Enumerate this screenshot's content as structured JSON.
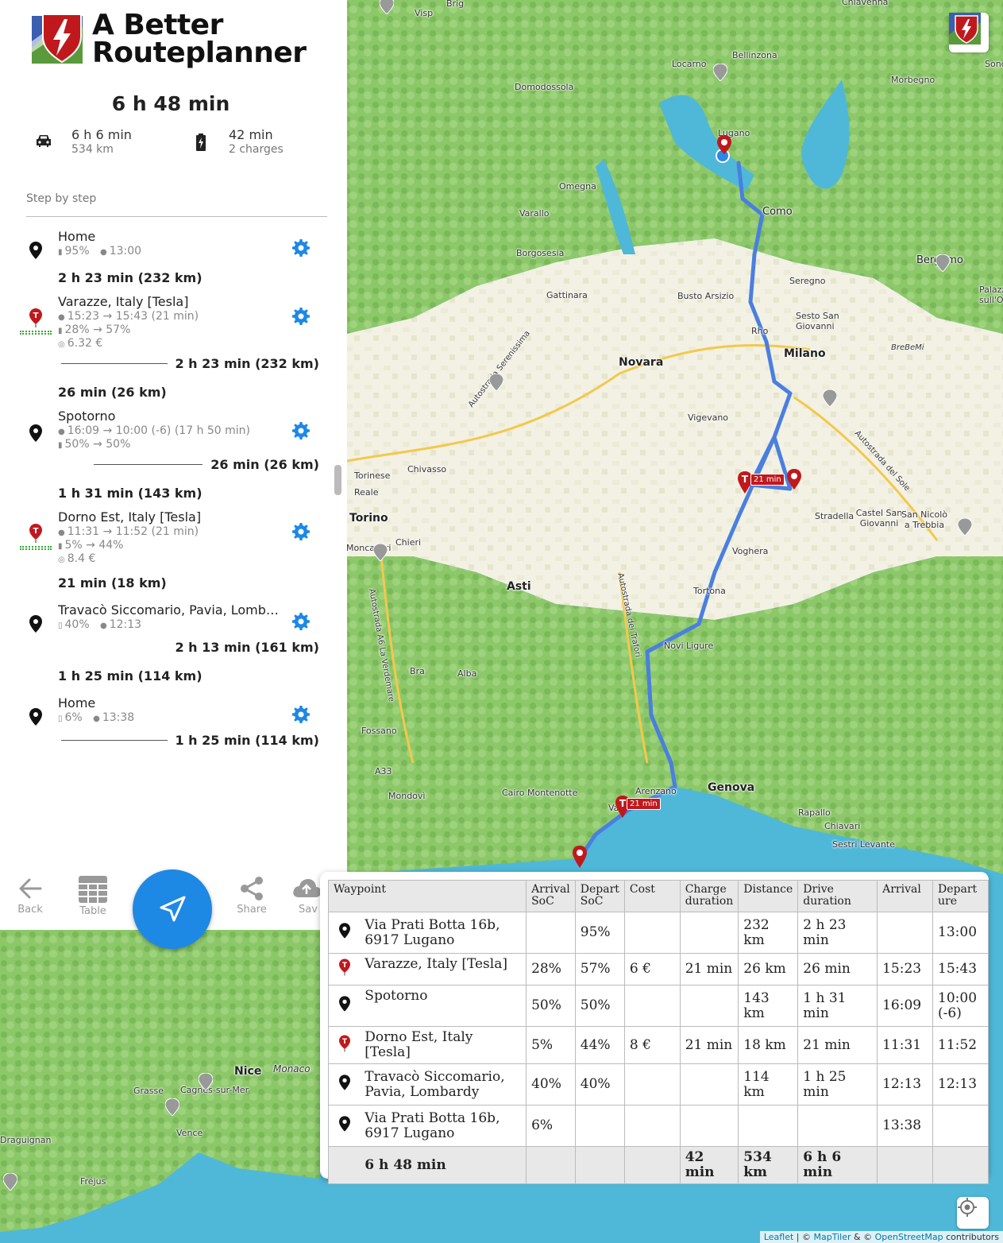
{
  "brand": {
    "line1": "A Better",
    "line2": "Routeplanner"
  },
  "summary": {
    "total": "6 h 48 min",
    "drive_time": "6 h 6 min",
    "drive_distance": "534 km",
    "charge_time": "42 min",
    "charge_count": "2 charges"
  },
  "steps_title": "Step by step",
  "steps": [
    {
      "name": "Home",
      "soc": "95%",
      "time": "13:00"
    },
    {
      "leg": "2 h 23 min (232 km)"
    },
    {
      "name": "Varazze, Italy [Tesla]",
      "time": "15:23 → 15:43 (21 min)",
      "soc": "28% → 57%",
      "cost": "6.32 €",
      "leg_after": "2 h 23 min (232 km)"
    },
    {
      "leg": "26 min (26 km)"
    },
    {
      "name": "Spotorno",
      "time": "16:09 → 10:00 (-6) (17 h 50 min)",
      "soc": "50% → 50%",
      "leg_after": "26 min (26 km)"
    },
    {
      "leg": "1 h 31 min (143 km)"
    },
    {
      "name": "Dorno Est, Italy [Tesla]",
      "time": "11:31 → 11:52 (21 min)",
      "soc": "5% → 44%",
      "cost": "8.4 €"
    },
    {
      "leg": "21 min (18 km)"
    },
    {
      "name": "Travacò Siccomario, Pavia, Lomb…",
      "soc": "40%",
      "time": "12:13",
      "leg_after": "2 h 13 min (161 km)"
    },
    {
      "leg": "1 h 25 min (114 km)"
    },
    {
      "name": "Home",
      "soc": "6%",
      "time": "13:38",
      "leg_after": "1 h 25 min (114 km)"
    }
  ],
  "toolbar": {
    "back": "Back",
    "table": "Table",
    "share": "Share",
    "save": "Sav"
  },
  "table": {
    "headers": [
      "Waypoint",
      "Arrival SoC",
      "Depart SoC",
      "Cost",
      "Charge duration",
      "Distance",
      "Drive duration",
      "Arrival",
      "Departure"
    ],
    "rows": [
      {
        "icon": "map-pin",
        "name": "Via Prati Botta 16b, 6917 Lugano",
        "arr_soc": "",
        "dep_soc": "95%",
        "cost": "",
        "charge": "",
        "distance": "232 km",
        "drive": "2 h 23 min",
        "arrival": "",
        "departure": "13:00"
      },
      {
        "icon": "supercharger",
        "name": "Varazze, Italy [Tesla]",
        "arr_soc": "28%",
        "dep_soc": "57%",
        "cost": "6 €",
        "charge": "21 min",
        "distance": "26 km",
        "drive": "26 min",
        "arrival": "15:23",
        "departure": "15:43"
      },
      {
        "icon": "map-pin",
        "name": "Spotorno",
        "arr_soc": "50%",
        "dep_soc": "50%",
        "cost": "",
        "charge": "",
        "distance": "143 km",
        "drive": "1 h 31 min",
        "arrival": "16:09",
        "departure": "10:00 (-6)"
      },
      {
        "icon": "supercharger",
        "name": "Dorno Est, Italy [Tesla]",
        "arr_soc": "5%",
        "dep_soc": "44%",
        "cost": "8 €",
        "charge": "21 min",
        "distance": "18 km",
        "drive": "21 min",
        "arrival": "11:31",
        "departure": "11:52"
      },
      {
        "icon": "map-pin",
        "name": "Travacò Siccomario, Pavia, Lombardy",
        "arr_soc": "40%",
        "dep_soc": "40%",
        "cost": "",
        "charge": "",
        "distance": "114 km",
        "drive": "1 h 25 min",
        "arrival": "12:13",
        "departure": "12:13"
      },
      {
        "icon": "map-pin",
        "name": "Via Prati Botta 16b, 6917 Lugano",
        "arr_soc": "6%",
        "dep_soc": "",
        "cost": "",
        "charge": "",
        "distance": "",
        "drive": "",
        "arrival": "13:38",
        "departure": ""
      }
    ],
    "footer": {
      "total": "6 h 48 min",
      "charge": "42 min",
      "distance": "534 km",
      "drive": "6 h 6 min"
    }
  },
  "map": {
    "labels": [
      "Visp",
      "Brig",
      "Chiavenna",
      "Locarno",
      "Bellinzona",
      "Sondrio",
      "Domodossola",
      "Morbegno",
      "Lugano",
      "Omegna",
      "Como",
      "Varallo",
      "Borgosesia",
      "Bergamo",
      "Gattinara",
      "Busto Arsizio",
      "Seregno",
      "Palazzolo sull'Oglio",
      "Rho",
      "Sesto San Giovanni",
      "Milano",
      "Novara",
      "BreBeMi",
      "Vigevano",
      "Autostrada Serenissima",
      "Autostrada del Sole",
      "Torinese",
      "Chivasso",
      "Reale",
      "Torino",
      "Castel San Giovanni",
      "San Nicolò a Trebbia",
      "Stradella",
      "Moncalieri",
      "Chieri",
      "Voghera",
      "Asti",
      "Tortona",
      "Autostrada A6 La Verdemare",
      "Autostrada dei Trafori",
      "Novi Ligure",
      "Bra",
      "Alba",
      "Fossano",
      "A33",
      "Mondovì",
      "Cairo Montenotte",
      "Arenzano",
      "Genova",
      "Rapallo",
      "Chiavari",
      "Sestri Levante",
      "Va",
      "Nice",
      "Monaco",
      "Grasse",
      "Cagnes-sur-Mer",
      "Vence",
      "Draguignan",
      "Fréjus"
    ],
    "charge_badge_1": "21 min",
    "charge_badge_2": "21 min",
    "route_color": "#4a7fe0"
  },
  "attribution": {
    "leaflet": "Leaflet",
    "sep1": " | © ",
    "maptiler": "MapTiler",
    "sep2": " & © ",
    "osm": "OpenStreetMap",
    "tail": " contributors"
  },
  "colors": {
    "accent": "#1e88e5",
    "charger_red": "#c0191d",
    "gear_blue": "#1e88e5"
  }
}
